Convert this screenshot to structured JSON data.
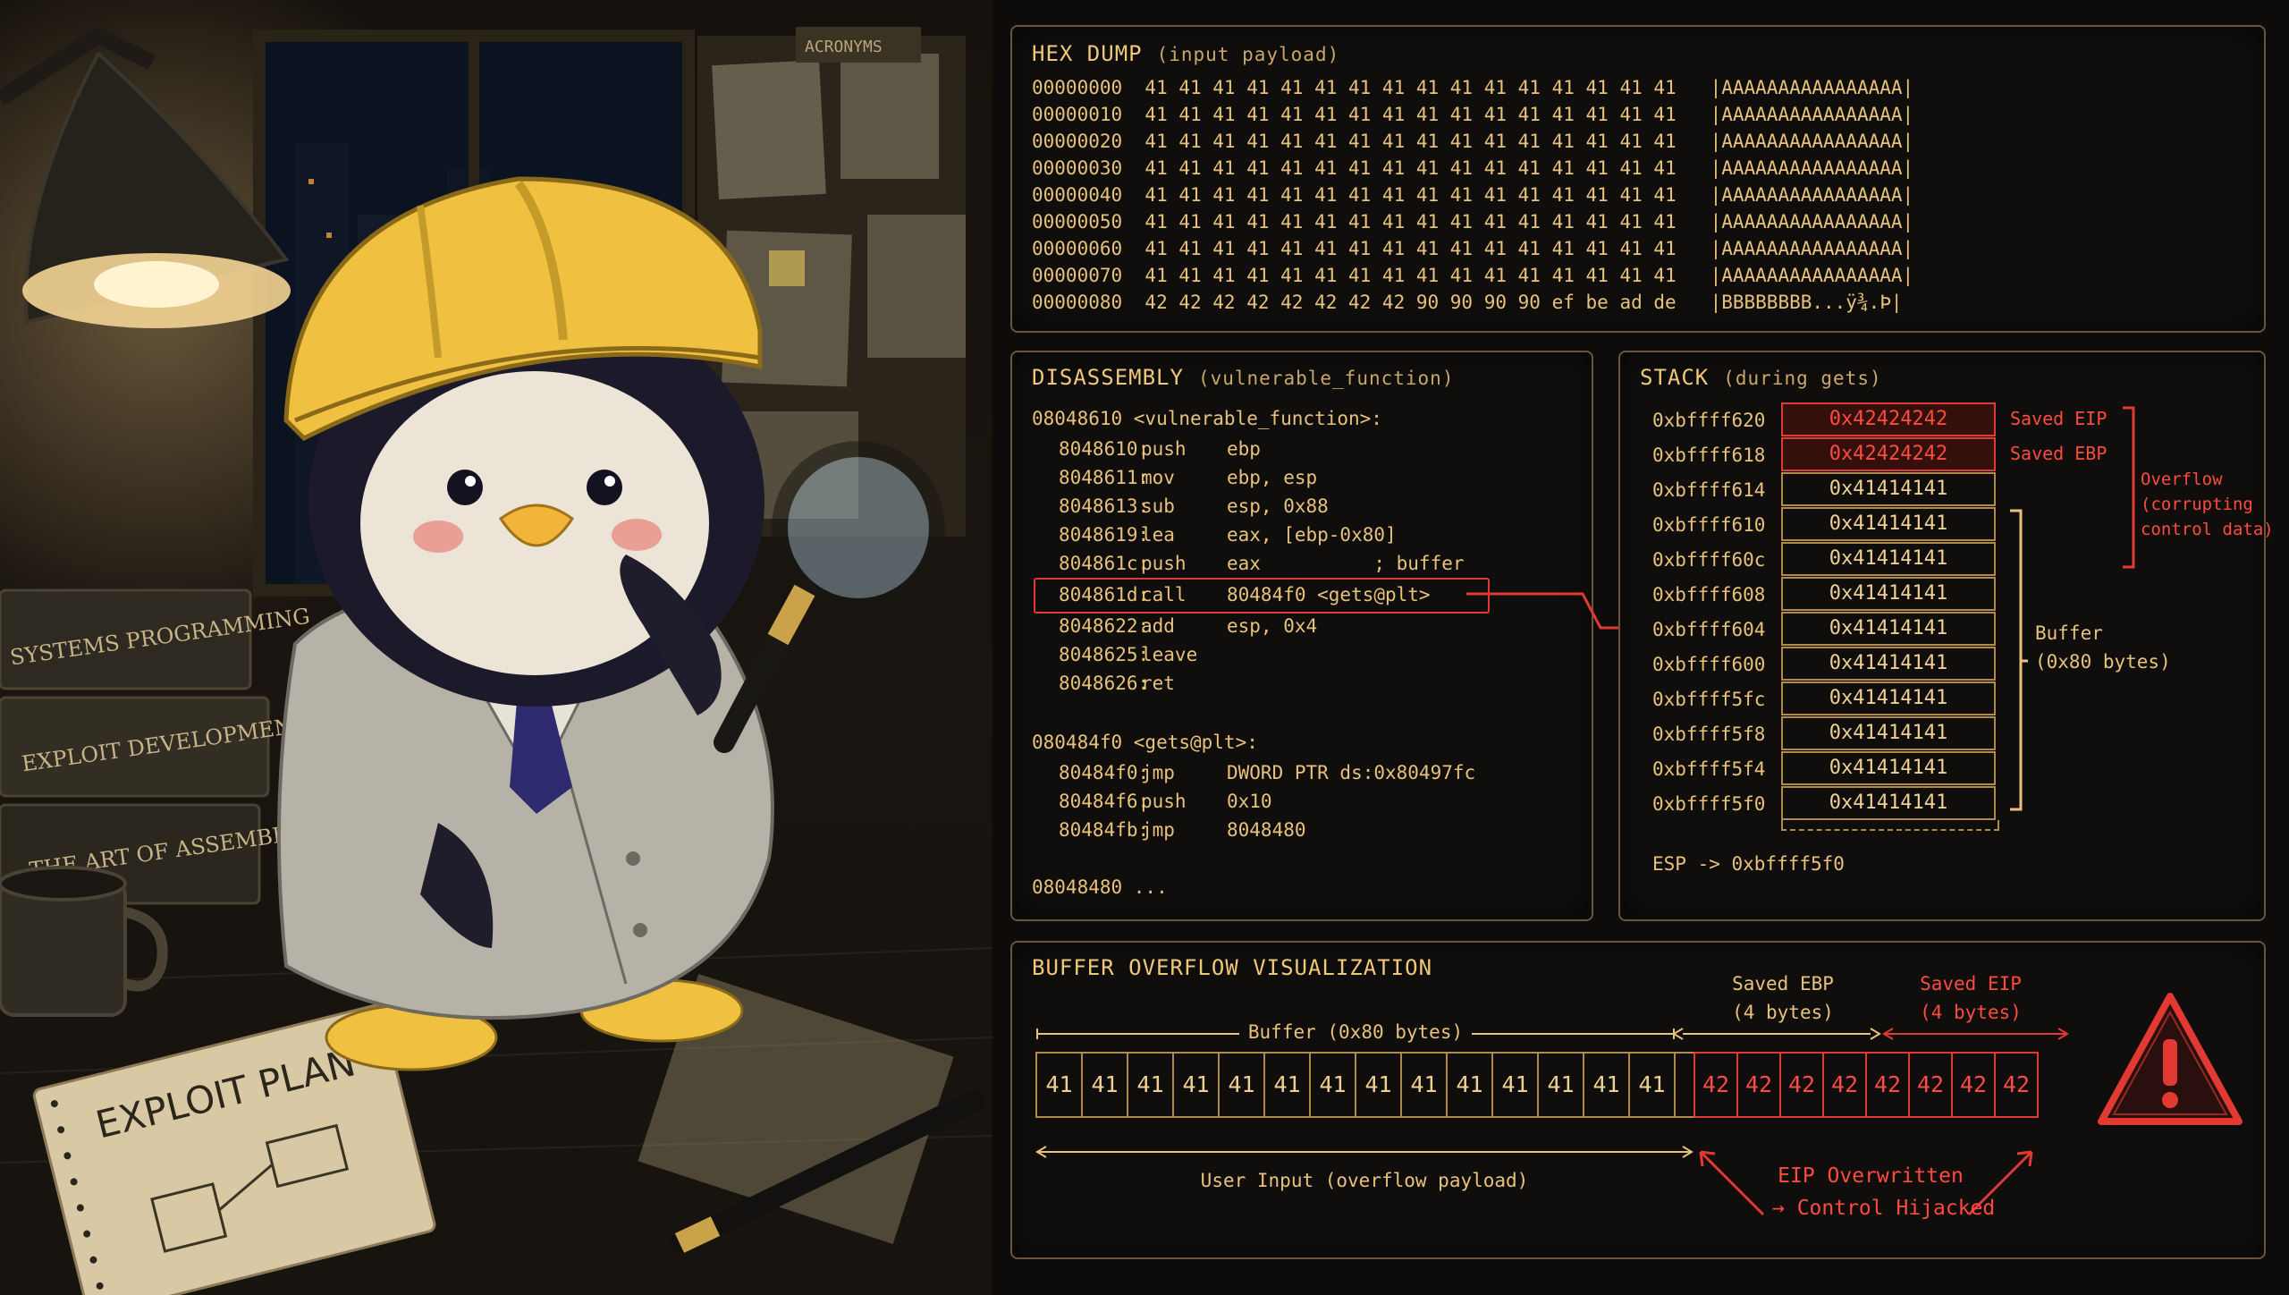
{
  "illustration": {
    "books": [
      "SYSTEMS PROGRAMMING",
      "EXPLOIT DEVELOPMENT",
      "THE ART OF ASSEMBLY"
    ],
    "notebook_text": "EXPLOIT PLAN",
    "shelf_label": "ACRONYMS"
  },
  "hexdump": {
    "title": "HEX DUMP",
    "subtitle": "(input payload)",
    "lines": [
      "00000000  41 41 41 41 41 41 41 41 41 41 41 41 41 41 41 41   |AAAAAAAAAAAAAAAA|",
      "00000010  41 41 41 41 41 41 41 41 41 41 41 41 41 41 41 41   |AAAAAAAAAAAAAAAA|",
      "00000020  41 41 41 41 41 41 41 41 41 41 41 41 41 41 41 41   |AAAAAAAAAAAAAAAA|",
      "00000030  41 41 41 41 41 41 41 41 41 41 41 41 41 41 41 41   |AAAAAAAAAAAAAAAA|",
      "00000040  41 41 41 41 41 41 41 41 41 41 41 41 41 41 41 41   |AAAAAAAAAAAAAAAA|",
      "00000050  41 41 41 41 41 41 41 41 41 41 41 41 41 41 41 41   |AAAAAAAAAAAAAAAA|",
      "00000060  41 41 41 41 41 41 41 41 41 41 41 41 41 41 41 41   |AAAAAAAAAAAAAAAA|",
      "00000070  41 41 41 41 41 41 41 41 41 41 41 41 41 41 41 41   |AAAAAAAAAAAAAAAA|",
      "00000080  42 42 42 42 42 42 42 42 90 90 90 90 ef be ad de   |BBBBBBBB...ÿ¾.Þ|"
    ]
  },
  "disassembly": {
    "title": "DISASSEMBLY",
    "subtitle": "(vulnerable_function)",
    "func_header": "08048610 <vulnerable_function>:",
    "instructions": [
      {
        "addr": "8048610:",
        "mn": "push",
        "op": "ebp"
      },
      {
        "addr": "8048611:",
        "mn": "mov",
        "op": "ebp, esp"
      },
      {
        "addr": "8048613:",
        "mn": "sub",
        "op": "esp, 0x88"
      },
      {
        "addr": "8048619:",
        "mn": "lea",
        "op": "eax, [ebp-0x80]"
      },
      {
        "addr": "804861c:",
        "mn": "push",
        "op": "eax          ; buffer"
      },
      {
        "addr": "804861d:",
        "mn": "call",
        "op": "80484f0 <gets@plt>"
      },
      {
        "addr": "8048622:",
        "mn": "add",
        "op": "esp, 0x4"
      },
      {
        "addr": "8048625:",
        "mn": "leave",
        "op": ""
      },
      {
        "addr": "8048626:",
        "mn": "ret",
        "op": ""
      }
    ],
    "plt_header": "080484f0 <gets@plt>:",
    "plt_instructions": [
      {
        "addr": "80484f0:",
        "mn": "jmp",
        "op": "DWORD PTR ds:0x80497fc"
      },
      {
        "addr": "80484f6:",
        "mn": "push",
        "op": "0x10"
      },
      {
        "addr": "80484fb:",
        "mn": "jmp",
        "op": "8048480"
      }
    ],
    "footer": "08048480 ..."
  },
  "stack": {
    "title": "STACK",
    "subtitle": "(during gets)",
    "rows": [
      {
        "addr": "0xbffff620",
        "value": "0x42424242",
        "label": "Saved EIP",
        "danger": true
      },
      {
        "addr": "0xbffff618",
        "value": "0x42424242",
        "label": "Saved EBP",
        "danger": true
      },
      {
        "addr": "0xbffff614",
        "value": "0x41414141",
        "label": "",
        "danger": false
      },
      {
        "addr": "0xbffff610",
        "value": "0x41414141",
        "label": "",
        "danger": false
      },
      {
        "addr": "0xbffff60c",
        "value": "0x41414141",
        "label": "",
        "danger": false
      },
      {
        "addr": "0xbffff608",
        "value": "0x41414141",
        "label": "",
        "danger": false
      },
      {
        "addr": "0xbffff604",
        "value": "0x41414141",
        "label": "",
        "danger": false
      },
      {
        "addr": "0xbffff600",
        "value": "0x41414141",
        "label": "",
        "danger": false
      },
      {
        "addr": "0xbffff5fc",
        "value": "0x41414141",
        "label": "",
        "danger": false
      },
      {
        "addr": "0xbffff5f8",
        "value": "0x41414141",
        "label": "",
        "danger": false
      },
      {
        "addr": "0xbffff5f4",
        "value": "0x41414141",
        "label": "",
        "danger": false
      },
      {
        "addr": "0xbffff5f0",
        "value": "0x41414141",
        "label": "",
        "danger": false
      }
    ],
    "overflow_note": [
      "Overflow",
      "(corrupting",
      "control data)"
    ],
    "buffer_note": [
      "Buffer",
      "(0x80 bytes)"
    ],
    "esp": "ESP -> 0xbffff5f0"
  },
  "visualization": {
    "title": "BUFFER OVERFLOW VISUALIZATION",
    "buffer_label": "Buffer (0x80 bytes)",
    "saved_ebp_label": [
      "Saved EBP",
      "(4 bytes)"
    ],
    "saved_eip_label": [
      "Saved EIP",
      "(4 bytes)"
    ],
    "buffer_cells": [
      "41",
      "41",
      "41",
      "41",
      "41",
      "41",
      "41",
      "41",
      "41",
      "41",
      "41",
      "41",
      "41",
      "41"
    ],
    "overflow_cells": [
      "42",
      "42",
      "42",
      "42",
      "42",
      "42",
      "42",
      "42"
    ],
    "user_input_label": "User Input (overflow payload)",
    "eip_overwritten": "EIP Overwritten",
    "control_hijacked": "→ Control Hijacked",
    "warning_icon": "warning-triangle-icon"
  },
  "colors": {
    "amber": "#e8c27a",
    "danger": "#e23a33",
    "hardhat": "#f0c040"
  }
}
